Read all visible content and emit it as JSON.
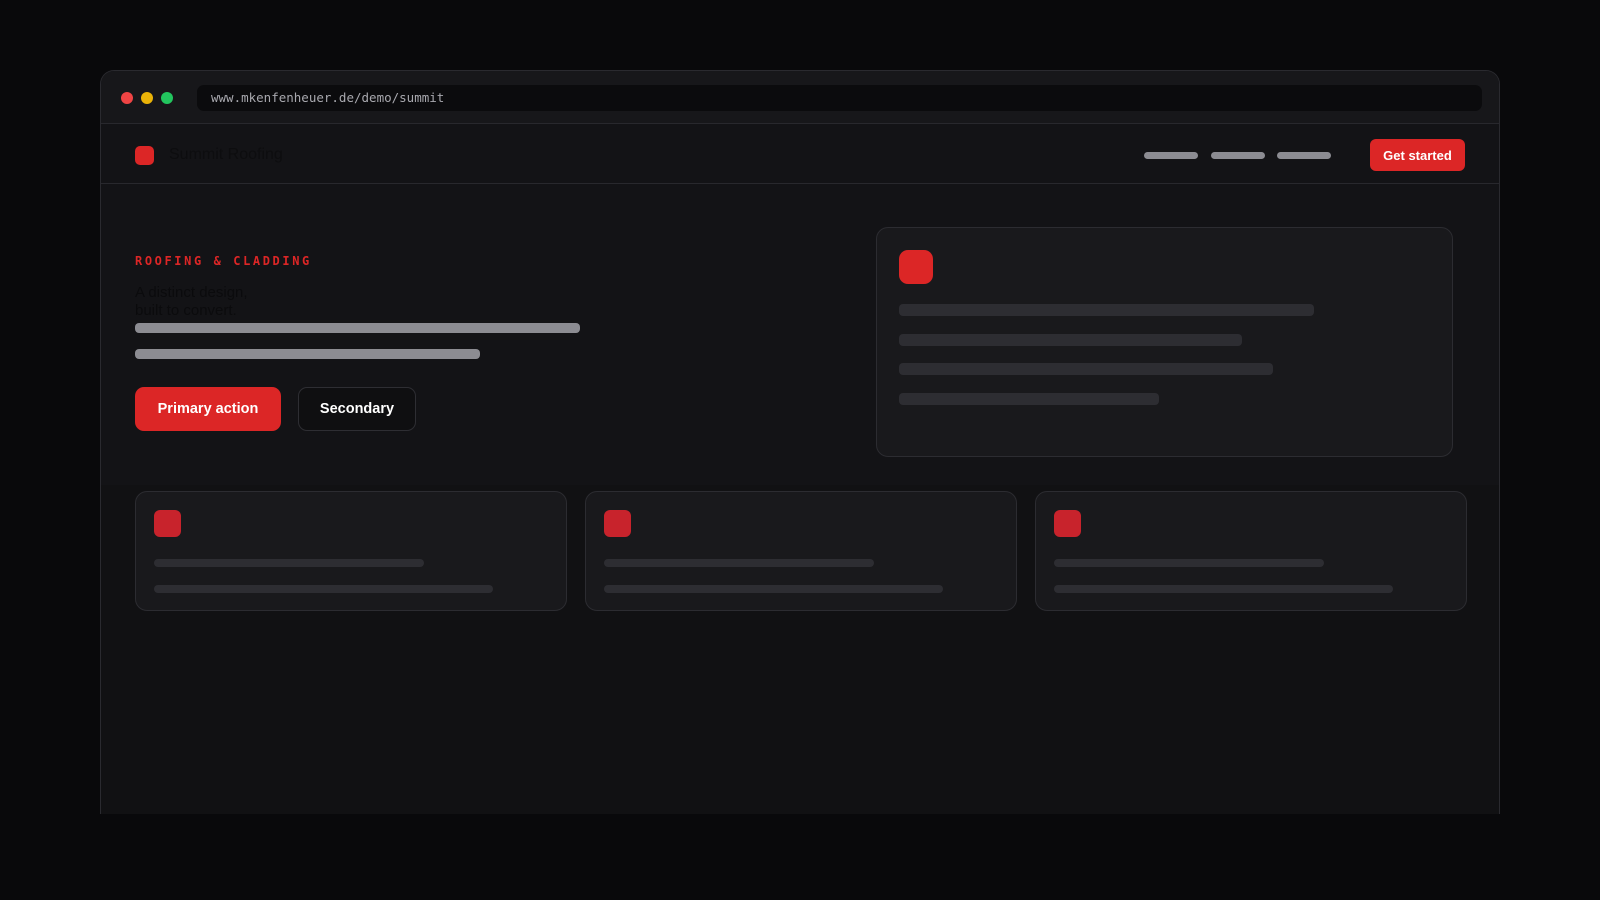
{
  "browser": {
    "url": "www.mkenfenheuer.de/demo/summit",
    "dots": [
      "#ef4444",
      "#eab308",
      "#22c55e"
    ]
  },
  "colors": {
    "accent": "#dc2626",
    "icon_red": "#c8232c"
  },
  "nav": {
    "brand_name": "Summit Roofing",
    "cta_label": "Get started"
  },
  "hero": {
    "eyebrow": "ROOFING & CLADDING",
    "headline_line1": "A distinct design,",
    "headline_line2": "built to convert.",
    "primary_label": "Primary action",
    "secondary_label": "Secondary"
  }
}
